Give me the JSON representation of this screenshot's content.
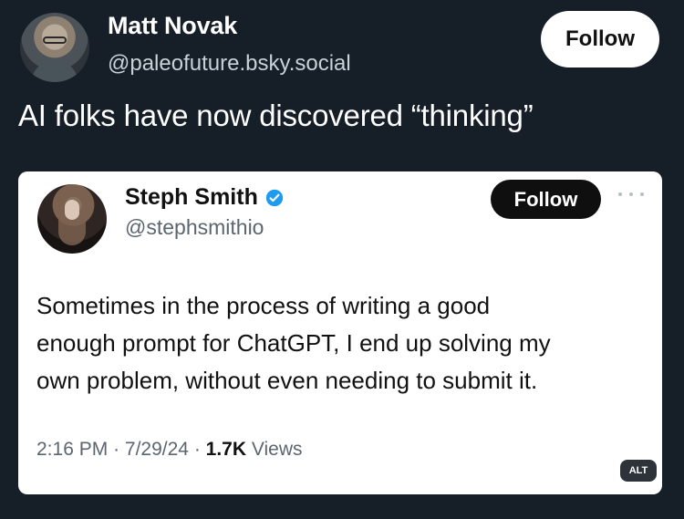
{
  "outer_post": {
    "author_name": "Matt Novak",
    "handle": "@paleofuture.bsky.social",
    "follow_label": "Follow",
    "text": "AI folks have now discovered “thinking”",
    "avatar_icon": "profile-photo"
  },
  "quoted_post": {
    "author_name": "Steph Smith",
    "handle": "@stephsmithio",
    "follow_label": "Follow",
    "verified_icon": "verified-badge",
    "more_icon": "more-options",
    "text_lines": [
      "Sometimes in the process of writing a good",
      "enough prompt for ChatGPT, I end up solving my",
      "own problem, without even needing to submit it."
    ],
    "time": "2:16 PM",
    "date": "7/29/24",
    "views_count": "1.7K",
    "views_label": "Views",
    "separator": "·",
    "alt_label": "ALT"
  },
  "colors": {
    "background": "#161e27",
    "card": "#ffffff",
    "verified_blue": "#1d9bf0",
    "muted_text": "#5b6670"
  }
}
